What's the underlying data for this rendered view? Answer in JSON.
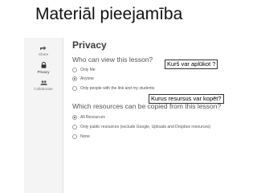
{
  "slide": {
    "title": "Materiāl pieejamība"
  },
  "sidebar": {
    "items": [
      {
        "label": "Share",
        "icon": "share-icon"
      },
      {
        "label": "Privacy",
        "icon": "lock-icon"
      },
      {
        "label": "Collaborate",
        "icon": "people-icon"
      }
    ],
    "active": "Privacy"
  },
  "main": {
    "heading": "Privacy",
    "view_question": "Who can view this lesson?",
    "view_options": [
      {
        "label": "Only Me",
        "selected": false
      },
      {
        "label": "Anyone",
        "selected": true
      },
      {
        "label": "Only people with the link and my students",
        "selected": false
      }
    ],
    "copy_question": "Which resources can be copied from this lesson?",
    "copy_options": [
      {
        "label": "All Resources",
        "selected": true
      },
      {
        "label": "Only public resources (exclude Google, Uploads and Dropbox resources)",
        "selected": false
      },
      {
        "label": "None",
        "selected": false
      }
    ]
  },
  "callouts": {
    "view": "Kurš var aplūkot ?",
    "copy": "Kurus resursus var kopēt?"
  }
}
